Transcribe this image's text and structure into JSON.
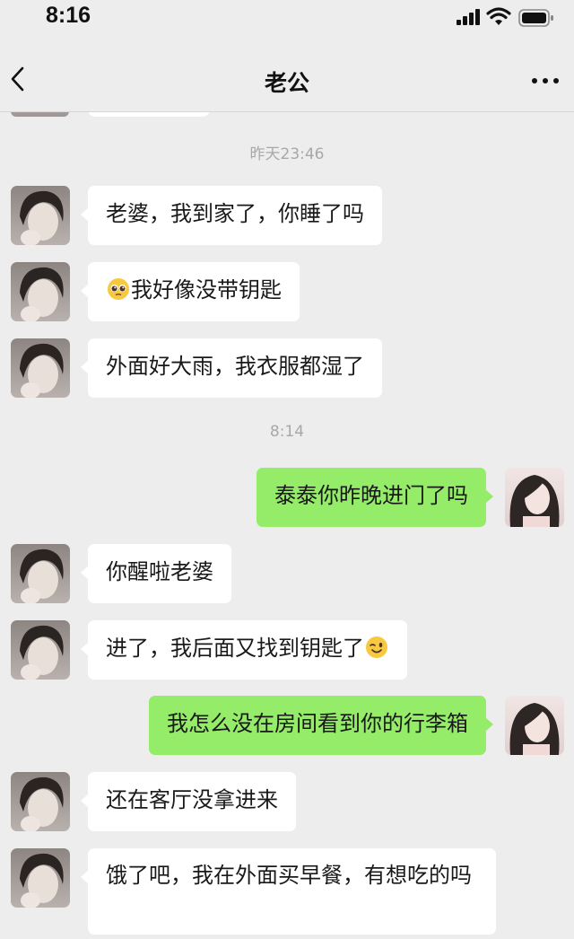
{
  "status_bar": {
    "time": "8:16"
  },
  "header": {
    "title": "老公",
    "back_icon": "chevron-left-icon",
    "more_icon": "more-dots-icon"
  },
  "timestamps": [
    "昨天23:46",
    "8:14"
  ],
  "messages": [
    {
      "side": "left",
      "text": "老婆，我到家了，你睡了吗"
    },
    {
      "side": "left",
      "emoji": "pleading-face-emoji",
      "text": "我好像没带钥匙"
    },
    {
      "side": "left",
      "text": "外面好大雨，我衣服都湿了"
    },
    {
      "side": "right",
      "text": "泰泰你昨晚进门了吗"
    },
    {
      "side": "left",
      "text": "你醒啦老婆"
    },
    {
      "side": "left",
      "text": "进了，我后面又找到钥匙了",
      "emoji_after": "winking-face-emoji"
    },
    {
      "side": "right",
      "text": "我怎么没在房间看到你的行李箱"
    },
    {
      "side": "left",
      "text": "还在客厅没拿进来"
    },
    {
      "side": "left",
      "text": "饿了吧，我在外面买早餐，有想吃的吗"
    }
  ],
  "colors": {
    "background": "#ededed",
    "incoming_bubble": "#ffffff",
    "outgoing_bubble": "#95ec69",
    "timestamp": "#a8a8a8"
  }
}
